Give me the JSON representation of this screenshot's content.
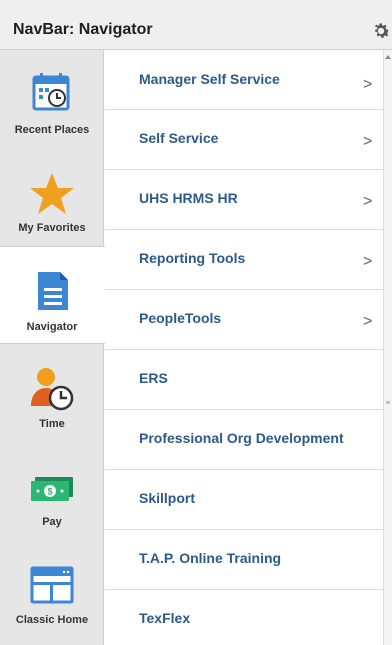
{
  "header": {
    "title": "NavBar: Navigator"
  },
  "sidebar": {
    "items": [
      {
        "label": "Recent Places",
        "icon": "calendar-clock-icon"
      },
      {
        "label": "My Favorites",
        "icon": "star-icon"
      },
      {
        "label": "Navigator",
        "icon": "document-icon",
        "active": true
      },
      {
        "label": "Time",
        "icon": "person-clock-icon"
      },
      {
        "label": "Pay",
        "icon": "money-icon"
      },
      {
        "label": "Classic Home",
        "icon": "window-icon"
      }
    ]
  },
  "menu": {
    "items": [
      {
        "label": "Manager Self Service",
        "chevron": ">"
      },
      {
        "label": "Self Service",
        "chevron": ">"
      },
      {
        "label": "UHS HRMS HR",
        "chevron": ">"
      },
      {
        "label": "Reporting Tools",
        "chevron": ">"
      },
      {
        "label": "PeopleTools",
        "chevron": ">"
      },
      {
        "label": "ERS"
      },
      {
        "label": "Professional Org Development"
      },
      {
        "label": "Skillport"
      },
      {
        "label": "T.A.P. Online Training"
      },
      {
        "label": "TexFlex"
      }
    ]
  },
  "colors": {
    "link": "#2c5a8a",
    "icon_blue": "#3b87d6",
    "star": "#f0a020",
    "money": "#2bb673"
  }
}
